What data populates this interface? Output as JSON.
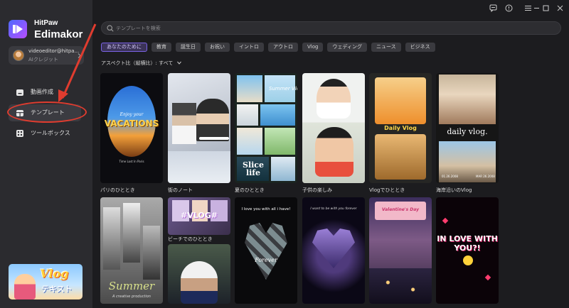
{
  "window": {
    "controls": [
      "feedback-icon",
      "help-icon",
      "menu-icon",
      "minimize-icon",
      "maximize-icon",
      "close-icon"
    ]
  },
  "sidebar": {
    "brand_small": "HitPaw",
    "brand_big": "Edimakor",
    "account": {
      "email": "videoeditor@hitpa...",
      "credit": "AIクレジット",
      "more_icon": "chevron-right-icon"
    },
    "nav": [
      {
        "label": "動画作成",
        "icon": "video-create-icon"
      },
      {
        "label": "テンプレート",
        "icon": "template-icon"
      },
      {
        "label": "ツールボックス",
        "icon": "toolbox-icon"
      }
    ],
    "promo": {
      "title": "Vlog",
      "subtitle": "テキスト"
    }
  },
  "main": {
    "search_placeholder": "テンプレートを検索",
    "categories": [
      "あなたのために",
      "教育",
      "誕生日",
      "お祝い",
      "イントロ",
      "アウトロ",
      "Vlog",
      "ウェディング",
      "ニュース",
      "ビジネス"
    ],
    "aspect_label": "アスペクト比（縦横比）: すべて",
    "templates": [
      {
        "label": "パリのひととき",
        "overlay": "VACATIONS",
        "overlay2": "Enjoy your",
        "overlay3": "Time Lost In Paris"
      },
      {
        "label": "街のノート",
        "overlay": ""
      },
      {
        "label": "夏のひととき",
        "overlay": "Slice life",
        "overlay2": "Summer Vlog"
      },
      {
        "label": "子供の楽しみ",
        "overlay": ""
      },
      {
        "label": "Vlogでひととき",
        "overlay": "Daily Vlog"
      },
      {
        "label": "海岸沿いのVlog",
        "overlay": "daily vlog.",
        "overlay2": "01.26.2008",
        "overlay3": "MAR 26.2008"
      },
      {
        "label": "",
        "overlay": "Summer",
        "overlay2": "A creative production"
      },
      {
        "label": "ビーチでのひととき",
        "overlay": "#VLOG#"
      },
      {
        "label": "",
        "overlay": "I love you with all i have!",
        "overlay2": "Forever"
      },
      {
        "label": "",
        "overlay": "I want to be with you forever"
      },
      {
        "label": "",
        "overlay": "Valentine's Day"
      },
      {
        "label": "",
        "overlay": "IN LOVE WITH YOU?!"
      }
    ]
  }
}
